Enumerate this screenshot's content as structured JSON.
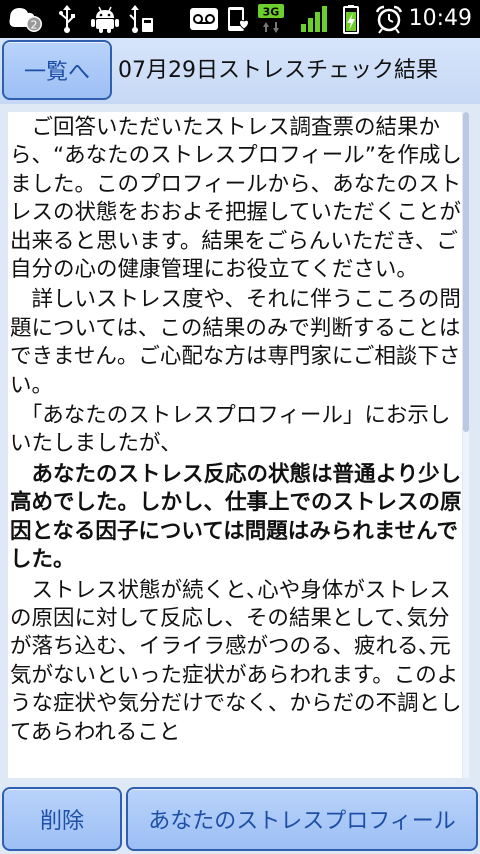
{
  "status_bar": {
    "notification_count": "2",
    "network_type": "3G",
    "time": "10:49"
  },
  "header": {
    "back_button_label": "一覧へ",
    "title": "07月29日ストレスチェック結果"
  },
  "content": {
    "paragraphs": [
      {
        "text": "　ご回答いただいたストレス調査票の結果から、“あなたのストレスプロフィール”を作成しました。このプロフィールから、あなたのストレスの状態をおおよそ把握していただくことが出来ると思います。結果をごらんいただき、ご自分の心の健康管理にお役立てください。",
        "bold": false
      },
      {
        "text": "　詳しいストレス度や、それに伴うこころの問題については、この結果のみで判断することはできません。ご心配な方は専門家にご相談下さい。",
        "bold": false
      },
      {
        "text": "　「あなたのストレスプロフィール」にお示しいたしましたが、",
        "bold": false
      },
      {
        "text": "　あなたのストレス反応の状態は普通より少し高めでした。しかし、仕事上でのストレスの原因となる因子については問題はみられませんでした。",
        "bold": true
      },
      {
        "text": "　ストレス状態が続くと､心や身体がストレスの原因に対して反応し、その結果として､気分が落ち込む、イライラ感がつのる、疲れる､元気がないといった症状があらわれます。このような症状や気分だけでなく、からだの不調としてあらわれること",
        "bold": false
      }
    ]
  },
  "footer": {
    "delete_button_label": "削除",
    "profile_button_label": "あなたのストレスプロフィール"
  },
  "colors": {
    "button_text": "#1e4fa6",
    "button_border": "#2f5fae",
    "battery_signal_green": "#6ccf2b"
  }
}
